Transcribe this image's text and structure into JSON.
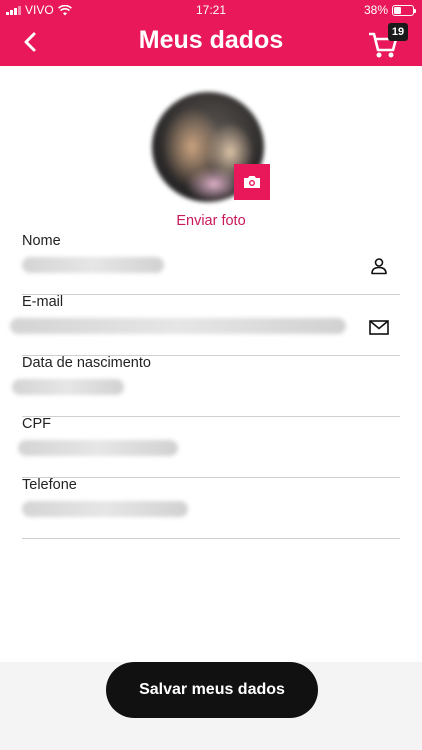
{
  "status_bar": {
    "carrier": "VIVO",
    "time": "17:21",
    "battery": "38%",
    "battery_level": 0.38,
    "signal_icon": "signal-icon",
    "wifi_icon": "wifi-icon"
  },
  "header": {
    "title": "Meus dados",
    "back_icon": "chevron-left-icon",
    "cart_icon": "cart-icon",
    "cart_count": "19",
    "background": "#e8185a"
  },
  "profile": {
    "photo_icon": "camera-icon",
    "send_photo_label": "Enviar foto"
  },
  "fields": [
    {
      "label": "Nome",
      "icon": "person-icon"
    },
    {
      "label": "E-mail",
      "icon": "mail-icon"
    },
    {
      "label": "Data de nascimento",
      "icon": ""
    },
    {
      "label": "CPF",
      "icon": ""
    },
    {
      "label": "Telefone",
      "icon": ""
    }
  ],
  "footer": {
    "save_label": "Salvar meus dados"
  }
}
